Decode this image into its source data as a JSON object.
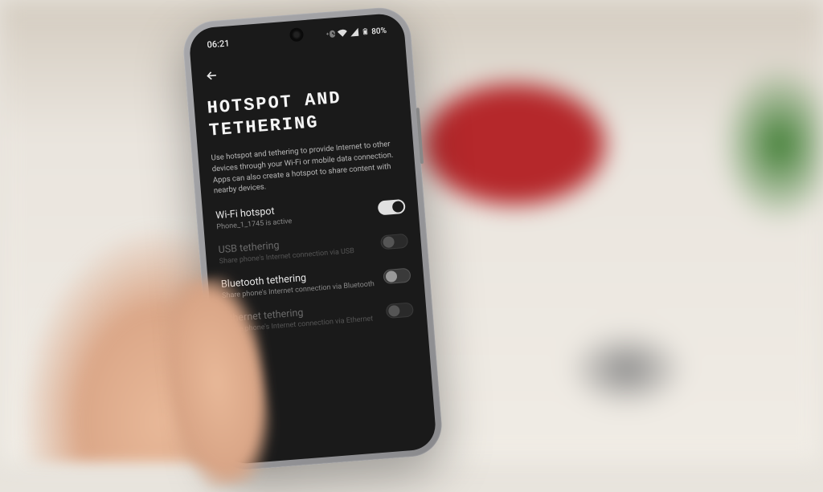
{
  "statusbar": {
    "time": "06:21",
    "battery_pct": "80%"
  },
  "page": {
    "title_line1": "HOTSPOT AND",
    "title_line2": "TETHERING",
    "description": "Use hotspot and tethering to provide Internet to other devices through your Wi-Fi or mobile data connection. Apps can also create a hotspot to share content with nearby devices."
  },
  "settings": [
    {
      "label": "Wi-Fi hotspot",
      "sub": "Phone_1_1745 is active",
      "state": "on",
      "disabled": false
    },
    {
      "label": "USB tethering",
      "sub": "Share phone's Internet connection via USB",
      "state": "off",
      "disabled": true
    },
    {
      "label": "Bluetooth tethering",
      "sub": "Share phone's Internet connection via Bluetooth",
      "state": "off",
      "disabled": false
    },
    {
      "label": "Ethernet tethering",
      "sub": "Share phone's Internet connection via Ethernet",
      "state": "off",
      "disabled": true
    }
  ]
}
